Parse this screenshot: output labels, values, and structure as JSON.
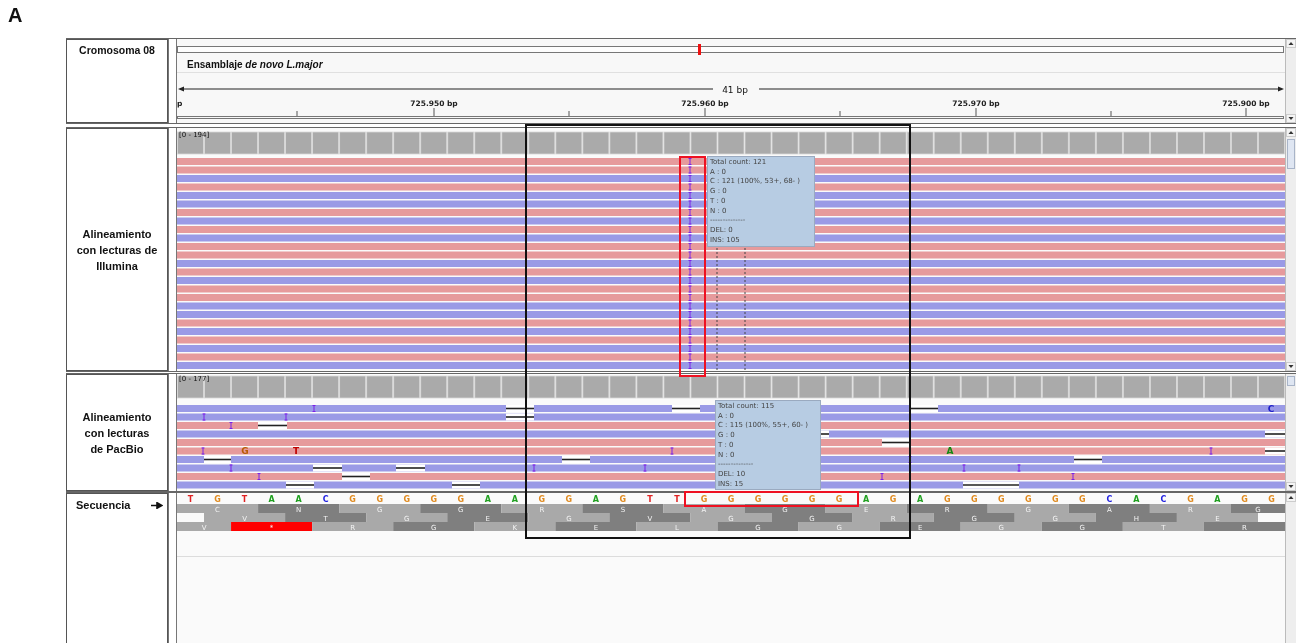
{
  "figure_label": "A",
  "header": {
    "name": "Cromosoma 08",
    "assembly": "Ensamblaje *de novo L.major*",
    "span": "41 bp",
    "edge_label": "p",
    "ticks": [
      "725.950 bp",
      "725.960 bp",
      "725.970 bp",
      "725.900 bp"
    ]
  },
  "illumina": {
    "name": "Alineamiento\ncon lecturas de\nIllumina",
    "range": "[0 - 194]",
    "reads": [
      {
        "color": "#e69a9c"
      },
      {
        "color": "#e69a9c"
      },
      {
        "color": "#9a9ae6"
      },
      {
        "color": "#e69a9c"
      },
      {
        "color": "#9a9ae6"
      },
      {
        "color": "#9a9ae6"
      },
      {
        "color": "#e69a9c"
      },
      {
        "color": "#9a9ae6"
      },
      {
        "color": "#e69a9c"
      },
      {
        "color": "#9a9ae6"
      },
      {
        "color": "#e69a9c"
      },
      {
        "color": "#e69a9c"
      },
      {
        "color": "#9a9ae6"
      },
      {
        "color": "#e69a9c"
      },
      {
        "color": "#9a9ae6"
      },
      {
        "color": "#e69a9c"
      },
      {
        "color": "#e69a9c"
      },
      {
        "color": "#9a9ae6"
      },
      {
        "color": "#9a9ae6"
      },
      {
        "color": "#e69a9c"
      },
      {
        "color": "#9a9ae6"
      },
      {
        "color": "#e69a9c"
      },
      {
        "color": "#9a9ae6"
      },
      {
        "color": "#e69a9c"
      },
      {
        "color": "#9a9ae6"
      }
    ],
    "tooltip": [
      "Total count: 121",
      "A : 0",
      "C : 121 (100%, 53+, 68- )",
      "G : 0",
      "T : 0",
      "N : 0",
      "--------------",
      "DEL: 0",
      "INS: 105"
    ]
  },
  "pacbio": {
    "name": "Alineamiento\ncon lecturas\nde PacBio",
    "range": "[0 - 177]",
    "reads": [
      {
        "color": "#9a9ae6"
      },
      {
        "color": "#9a9ae6"
      },
      {
        "color": "#e69a9c"
      },
      {
        "color": "#9a9ae6"
      },
      {
        "color": "#e69a9c"
      },
      {
        "color": "#e69a9c"
      },
      {
        "color": "#9a9ae6"
      },
      {
        "color": "#9a9ae6"
      },
      {
        "color": "#e69a9c"
      },
      {
        "color": "#9a9ae6"
      }
    ],
    "mismatches": [
      {
        "base": "G",
        "color": "#b85a00"
      },
      {
        "base": "T",
        "color": "#c00000"
      },
      {
        "base": "A",
        "color": "#138a13"
      },
      {
        "base": "C",
        "color": "#2020c8"
      }
    ],
    "tooltip": [
      "Total count: 115",
      "A : 0",
      "C : 115 (100%, 55+, 60- )",
      "G : 0",
      "T : 0",
      "N : 0",
      "--------------",
      "DEL: 10",
      "INS: 15"
    ]
  },
  "sequence": {
    "name": "Secuencia",
    "bases": [
      {
        "b": "T",
        "color": "#e02020"
      },
      {
        "b": "G",
        "color": "#e08a1e"
      },
      {
        "b": "T",
        "color": "#e02020"
      },
      {
        "b": "A",
        "color": "#20a020"
      },
      {
        "b": "A",
        "color": "#20a020"
      },
      {
        "b": "C",
        "color": "#2020e0"
      },
      {
        "b": "G",
        "color": "#e08a1e"
      },
      {
        "b": "G",
        "color": "#e08a1e"
      },
      {
        "b": "G",
        "color": "#e08a1e"
      },
      {
        "b": "G",
        "color": "#e08a1e"
      },
      {
        "b": "G",
        "color": "#e08a1e"
      },
      {
        "b": "A",
        "color": "#20a020"
      },
      {
        "b": "A",
        "color": "#20a020"
      },
      {
        "b": "G",
        "color": "#e08a1e"
      },
      {
        "b": "G",
        "color": "#e08a1e"
      },
      {
        "b": "A",
        "color": "#20a020"
      },
      {
        "b": "G",
        "color": "#e08a1e"
      },
      {
        "b": "T",
        "color": "#e02020"
      },
      {
        "b": "T",
        "color": "#e02020"
      },
      {
        "b": "G",
        "color": "#e08a1e"
      },
      {
        "b": "G",
        "color": "#e08a1e"
      },
      {
        "b": "G",
        "color": "#e08a1e"
      },
      {
        "b": "G",
        "color": "#e08a1e"
      },
      {
        "b": "G",
        "color": "#e08a1e"
      },
      {
        "b": "G",
        "color": "#e08a1e"
      },
      {
        "b": "A",
        "color": "#20a020"
      },
      {
        "b": "G",
        "color": "#e08a1e"
      },
      {
        "b": "A",
        "color": "#20a020"
      },
      {
        "b": "G",
        "color": "#e08a1e"
      },
      {
        "b": "G",
        "color": "#e08a1e"
      },
      {
        "b": "G",
        "color": "#e08a1e"
      },
      {
        "b": "G",
        "color": "#e08a1e"
      },
      {
        "b": "G",
        "color": "#e08a1e"
      },
      {
        "b": "G",
        "color": "#e08a1e"
      },
      {
        "b": "C",
        "color": "#2020e0"
      },
      {
        "b": "A",
        "color": "#20a020"
      },
      {
        "b": "C",
        "color": "#2020e0"
      },
      {
        "b": "G",
        "color": "#e08a1e"
      },
      {
        "b": "A",
        "color": "#20a020"
      },
      {
        "b": "G",
        "color": "#e08a1e"
      },
      {
        "b": "G",
        "color": "#e08a1e"
      }
    ],
    "frames": [
      [
        {
          "aa": "C",
          "kind": "amino"
        },
        {
          "aa": "N",
          "kind": "amino"
        },
        {
          "aa": "G",
          "kind": "amino"
        },
        {
          "aa": "G",
          "kind": "amino"
        },
        {
          "aa": "R",
          "kind": "amino"
        },
        {
          "aa": "S",
          "kind": "amino"
        },
        {
          "aa": "A",
          "kind": "amino"
        },
        {
          "aa": "G",
          "kind": "amino"
        },
        {
          "aa": "E",
          "kind": "amino"
        },
        {
          "aa": "R",
          "kind": "amino"
        },
        {
          "aa": "G",
          "kind": "amino"
        },
        {
          "aa": "A",
          "kind": "amino"
        },
        {
          "aa": "R",
          "kind": "amino"
        },
        {
          "aa": "G",
          "kind": "amino"
        }
      ],
      [
        {
          "aa": "V",
          "kind": "amino"
        },
        {
          "aa": "T",
          "kind": "amino"
        },
        {
          "aa": "G",
          "kind": "amino"
        },
        {
          "aa": "E",
          "kind": "amino"
        },
        {
          "aa": "G",
          "kind": "amino"
        },
        {
          "aa": "V",
          "kind": "amino"
        },
        {
          "aa": "G",
          "kind": "amino"
        },
        {
          "aa": "G",
          "kind": "amino"
        },
        {
          "aa": "R",
          "kind": "amino"
        },
        {
          "aa": "G",
          "kind": "amino"
        },
        {
          "aa": "G",
          "kind": "amino"
        },
        {
          "aa": "H",
          "kind": "amino"
        },
        {
          "aa": "E",
          "kind": "amino"
        }
      ],
      [
        {
          "aa": "V",
          "kind": "amino"
        },
        {
          "aa": "*",
          "kind": "stop"
        },
        {
          "aa": "R",
          "kind": "amino"
        },
        {
          "aa": "G",
          "kind": "amino"
        },
        {
          "aa": "K",
          "kind": "amino"
        },
        {
          "aa": "E",
          "kind": "amino"
        },
        {
          "aa": "L",
          "kind": "amino"
        },
        {
          "aa": "G",
          "kind": "amino"
        },
        {
          "aa": "G",
          "kind": "amino"
        },
        {
          "aa": "E",
          "kind": "amino"
        },
        {
          "aa": "G",
          "kind": "amino"
        },
        {
          "aa": "G",
          "kind": "amino"
        },
        {
          "aa": "T",
          "kind": "amino"
        },
        {
          "aa": "R",
          "kind": "amino"
        }
      ]
    ]
  }
}
